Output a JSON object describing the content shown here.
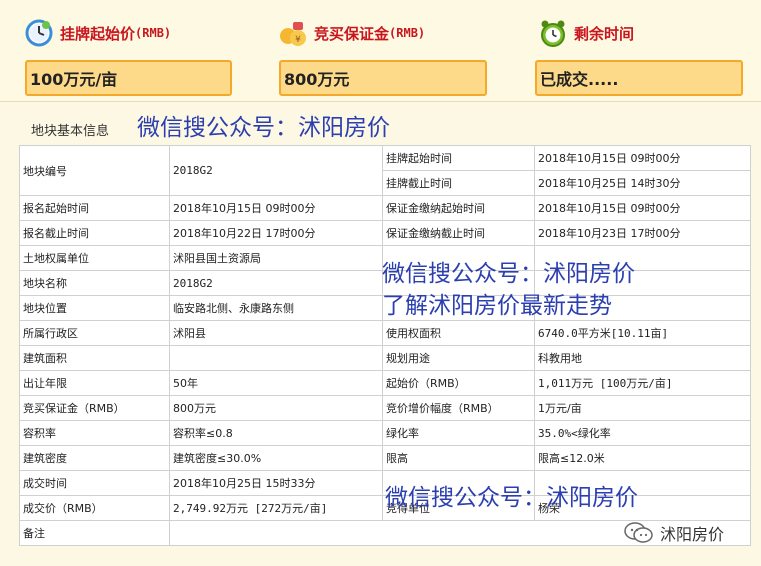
{
  "header": {
    "start_price": {
      "label": "挂牌起始价",
      "unit": "(RMB)",
      "value": "100万元/亩"
    },
    "deposit": {
      "label": "竞买保证金",
      "unit": "(RMB)",
      "value": "800万元"
    },
    "remaining": {
      "label": "剩余时间",
      "value": "已成交....."
    }
  },
  "section_title": "地块基本信息",
  "watermarks": {
    "wm1": "微信搜公众号：沭阳房价",
    "wm2": "微信搜公众号：沭阳房价",
    "wm3": "了解沭阳房价最新走势",
    "wm4": "微信搜公众号：沭阳房价"
  },
  "brand": {
    "name": "沭阳房价",
    "icon": "wechat-icon"
  },
  "table": {
    "r1": {
      "k1": "地块编号",
      "v1": "2018G2",
      "k2a": "挂牌起始时间",
      "v2a": "2018年10月15日 09时00分",
      "k2b": "挂牌截止时间",
      "v2b": "2018年10月25日 14时30分"
    },
    "r2": {
      "k1": "报名起始时间",
      "v1": "2018年10月15日 09时00分",
      "k2": "保证金缴纳起始时间",
      "v2": "2018年10月15日 09时00分"
    },
    "r3": {
      "k1": "报名截止时间",
      "v1": "2018年10月22日 17时00分",
      "k2": "保证金缴纳截止时间",
      "v2": "2018年10月23日 17时00分"
    },
    "r4": {
      "k1": "土地权属单位",
      "v1": "沭阳县国土资源局",
      "k2": "",
      "v2": ""
    },
    "r5": {
      "k1": "地块名称",
      "v1": "2018G2",
      "k2": "",
      "v2": ""
    },
    "r6": {
      "k1": "地块位置",
      "v1": "临安路北侧、永康路东侧",
      "k2": "",
      "v2": ""
    },
    "r7": {
      "k1": "所属行政区",
      "v1": "沭阳县",
      "k2": "使用权面积",
      "v2": "6740.0平方米[10.11亩]"
    },
    "r8": {
      "k1": "建筑面积",
      "v1": "",
      "k2": "规划用途",
      "v2": "科教用地"
    },
    "r9": {
      "k1": "出让年限",
      "v1": "50年",
      "k2": "起始价（RMB）",
      "v2": "1,011万元 [100万元/亩]"
    },
    "r10": {
      "k1": "竞买保证金（RMB）",
      "v1": "800万元",
      "k2": "竞价增价幅度（RMB）",
      "v2": "1万元/亩"
    },
    "r11": {
      "k1": "容积率",
      "v1": "容积率≤0.8",
      "k2": "绿化率",
      "v2": "35.0%<绿化率"
    },
    "r12": {
      "k1": "建筑密度",
      "v1": "建筑密度≤30.0%",
      "k2": "限高",
      "v2": "限高≤12.0米"
    },
    "r13": {
      "k1": "成交时间",
      "v1": "2018年10月25日 15时33分",
      "k2": "",
      "v2": ""
    },
    "r14": {
      "k1": "成交价（RMB）",
      "v1": "2,749.92万元 [272万元/亩]",
      "k2": "竞得单位",
      "v2": "杨荣"
    },
    "r15": {
      "k1": "备注",
      "v1": ""
    }
  },
  "colors": {
    "accent_red": "#c8161e",
    "box_fill": "#fdd98a",
    "box_border": "#f2a92c",
    "watermark_blue": "#2b3fb0"
  }
}
